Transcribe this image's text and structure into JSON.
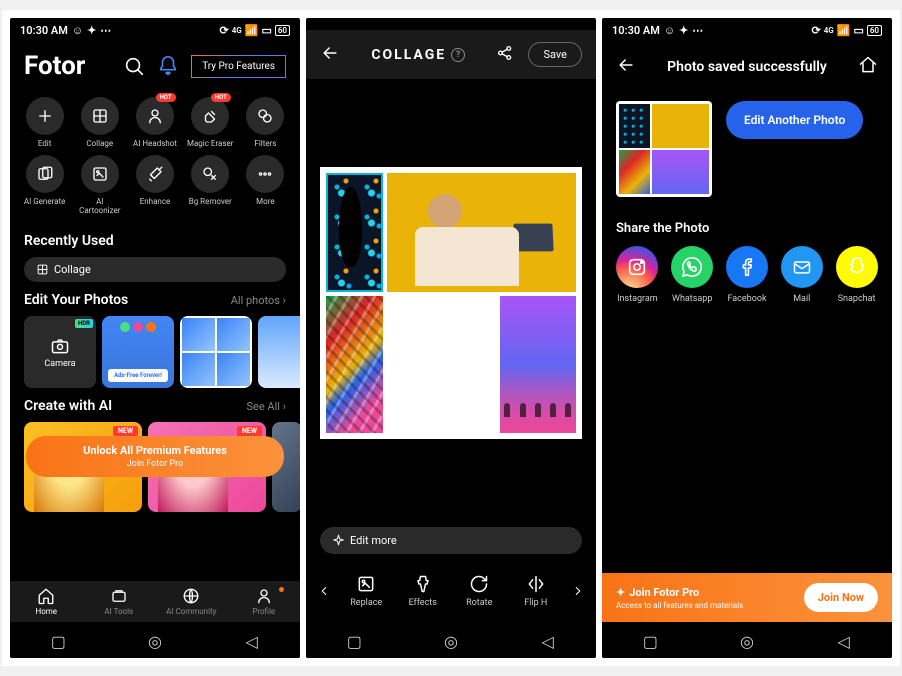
{
  "status": {
    "time": "10:30 AM",
    "battery": "60"
  },
  "p1": {
    "title": "Fotor",
    "try_pro": "Try Pro Features",
    "tools": [
      {
        "label": "Edit"
      },
      {
        "label": "Collage"
      },
      {
        "label": "AI Headshot",
        "hot": true
      },
      {
        "label": "Magic Eraser",
        "hot": true
      },
      {
        "label": "Filters"
      },
      {
        "label": "AI Generate"
      },
      {
        "label": "AI Cartoonizer"
      },
      {
        "label": "Enhance"
      },
      {
        "label": "Bg Remover"
      },
      {
        "label": "More"
      }
    ],
    "recent_h": "Recently Used",
    "recent_chip": "Collage",
    "edit_h": "Edit Your Photos",
    "edit_link": "All photos",
    "camera": "Camera",
    "hdr": "HDR",
    "ads_free": "Ads-Free Forever!",
    "create_h": "Create with AI",
    "see_all": "See All",
    "new": "NEW",
    "unlock_title": "Unlock All Premium Features",
    "unlock_sub": "Join Fotor Pro",
    "nav": [
      "Home",
      "AI Tools",
      "AI Community",
      "Profile"
    ]
  },
  "p2": {
    "title": "COLLAGE",
    "save": "Save",
    "edit_more": "Edit more",
    "tools": [
      "Replace",
      "Effects",
      "Rotate",
      "Flip H"
    ]
  },
  "p3": {
    "title": "Photo saved successfully",
    "edit_another": "Edit Another Photo",
    "share_h": "Share the Photo",
    "share": [
      "Instagram",
      "Whatsapp",
      "Facebook",
      "Mail",
      "Snapchat"
    ],
    "footer_title": "Join Fotor Pro",
    "footer_sub": "Access to all features and materials",
    "join": "Join Now"
  }
}
